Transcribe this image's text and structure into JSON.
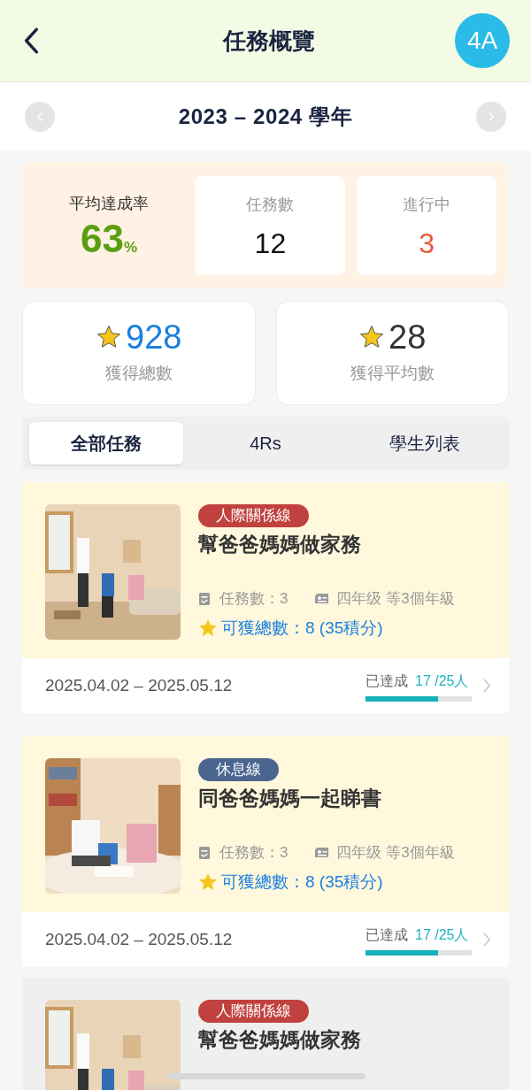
{
  "header": {
    "title": "任務概覽",
    "class_badge": "4A"
  },
  "year_selector": {
    "label": "2023 – 2024 學年"
  },
  "summary": {
    "rate_label": "平均達成率",
    "rate_value": "63",
    "rate_unit": "%",
    "tasks_label": "任務數",
    "tasks_value": "12",
    "ongoing_label": "進行中",
    "ongoing_value": "3"
  },
  "star_stats": [
    {
      "value": "928",
      "label": "獲得總數",
      "kind": "total"
    },
    {
      "value": "28",
      "label": "獲得平均數",
      "kind": "average"
    }
  ],
  "tabs": [
    {
      "label": "全部任務",
      "selected": true
    },
    {
      "label": "4Rs",
      "selected": false
    },
    {
      "label": "學生列表",
      "selected": false
    }
  ],
  "tasks": [
    {
      "greyed": false,
      "tag": "人際關係線",
      "color": "#c0413d",
      "title": "幫爸爸媽媽做家務",
      "task_count": "任務數：3",
      "grades": "四年级 等3個年級",
      "reward": "可獲總數：8 (35積分)",
      "dates": "2025.04.02 – 2025.05.12",
      "achieved_label": "已達成",
      "achieved_count": "17 /25人",
      "level": 0.68
    },
    {
      "greyed": false,
      "tag": "休息線",
      "color": "#4a6690",
      "title": "同爸爸媽媽一起睇書",
      "task_count": "任務數：3",
      "grades": "四年级 等3個年級",
      "reward": "可獲總數：8 (35積分)",
      "dates": "2025.04.02 – 2025.05.12",
      "achieved_label": "已達成",
      "achieved_count": "17 /25人",
      "level": 0.68
    },
    {
      "greyed": true,
      "tag": "人際關係線",
      "color": "#c0413d",
      "title": "幫爸爸媽媽做家務"
    }
  ]
}
